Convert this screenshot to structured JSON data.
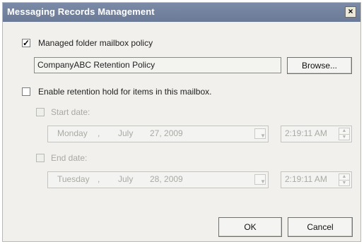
{
  "window": {
    "title": "Messaging Records Management",
    "close_symbol": "×"
  },
  "policy": {
    "checkbox_checked": true,
    "label": "Managed folder mailbox policy",
    "value": "CompanyABC Retention Policy",
    "browse_label": "Browse..."
  },
  "retention_hold": {
    "checkbox_checked": false,
    "label": "Enable retention hold for items in this mailbox."
  },
  "start_date": {
    "label": "Start date:",
    "weekday": "Monday",
    "comma": ",",
    "month": "July",
    "day_year": "27, 2009",
    "time": "2:19:11 AM"
  },
  "end_date": {
    "label": "End date:",
    "weekday": "Tuesday",
    "comma": ",",
    "month": "July",
    "day_year": "28, 2009",
    "time": "2:19:11 AM"
  },
  "buttons": {
    "ok_label": "OK",
    "cancel_label": "Cancel"
  },
  "icons": {
    "check": "✓",
    "dropdown": "▼",
    "spin_up": "▲",
    "spin_down": "▼"
  },
  "colors": {
    "titlebar": "#6f7e9b",
    "dialog_bg": "#f1f0ec",
    "disabled_text": "#a8a8a4"
  }
}
